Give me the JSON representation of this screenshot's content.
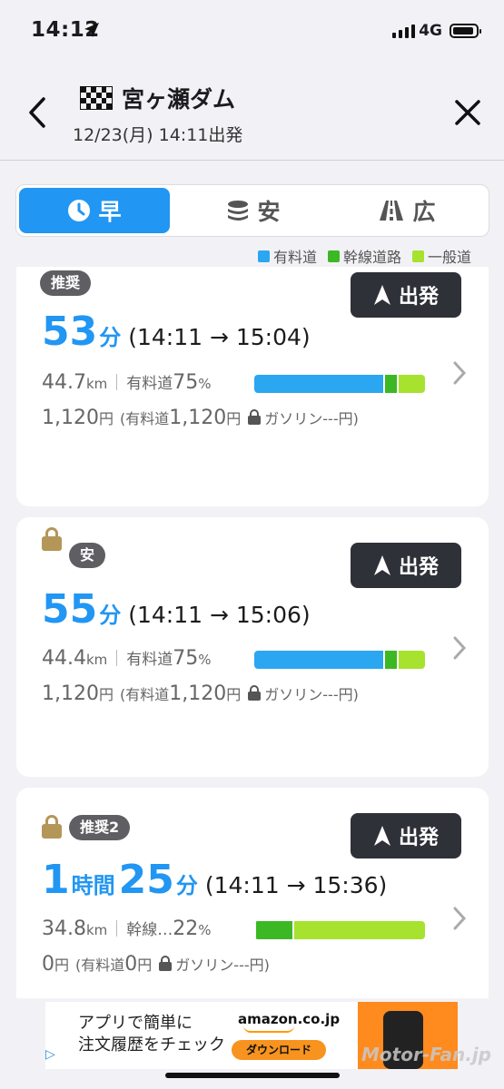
{
  "status": {
    "time": "14:12",
    "network": "4G"
  },
  "header": {
    "destination": "宮ヶ瀬ダム",
    "departure": "12/23(月) 14:11出発"
  },
  "tabs": [
    {
      "label": "早",
      "icon": "clock-icon",
      "active": true
    },
    {
      "label": "安",
      "icon": "coins-icon",
      "active": false
    },
    {
      "label": "広",
      "icon": "road-icon",
      "active": false
    }
  ],
  "legend": [
    {
      "label": "有料道",
      "color": "#2aa7f0"
    },
    {
      "label": "幹線道路",
      "color": "#3cb825"
    },
    {
      "label": "一般道",
      "color": "#a6e22e"
    }
  ],
  "routes": [
    {
      "badge": "推奨",
      "locked": false,
      "go_label": "出発",
      "hours": "",
      "hours_unit": "",
      "minutes": "53",
      "minutes_unit": "分",
      "time_range": "(14:11 → 15:04)",
      "distance": "44.7",
      "distance_unit": "km",
      "road_label": "有料道",
      "road_pct": "75",
      "pct_unit": "%",
      "bar": [
        0.77,
        0.07,
        0.16
      ],
      "cost": "1,120",
      "cost_unit": "円",
      "toll_label": "(有料道",
      "toll": "1,120",
      "toll_unit": "円",
      "gas_label": "ガソリン",
      "gas_value": "---",
      "gas_unit": "円)"
    },
    {
      "badge": "安",
      "locked": true,
      "go_label": "出発",
      "hours": "",
      "hours_unit": "",
      "minutes": "55",
      "minutes_unit": "分",
      "time_range": "(14:11 → 15:06)",
      "distance": "44.4",
      "distance_unit": "km",
      "road_label": "有料道",
      "road_pct": "75",
      "pct_unit": "%",
      "bar": [
        0.77,
        0.07,
        0.16
      ],
      "cost": "1,120",
      "cost_unit": "円",
      "toll_label": "(有料道",
      "toll": "1,120",
      "toll_unit": "円",
      "gas_label": "ガソリン",
      "gas_value": "---",
      "gas_unit": "円)"
    },
    {
      "badge": "推奨2",
      "locked": true,
      "go_label": "出発",
      "hours": "1",
      "hours_unit": "時間",
      "minutes": "25",
      "minutes_unit": "分",
      "time_range": "(14:11 → 15:36)",
      "distance": "34.8",
      "distance_unit": "km",
      "road_label": "幹線…",
      "road_pct": "22",
      "pct_unit": "%",
      "bar": [
        0,
        0.22,
        0.78
      ],
      "cost": "0",
      "cost_unit": "円",
      "toll_label": "(有料道",
      "toll": "0",
      "toll_unit": "円",
      "gas_label": "ガソリン",
      "gas_value": "---",
      "gas_unit": "円)"
    }
  ],
  "ad": {
    "line1": "アプリで簡単に",
    "line2": "注文履歴をチェック",
    "brand": "amazon.co.jp",
    "button": "ダウンロード"
  },
  "watermark": "Motor-Fan.jp"
}
